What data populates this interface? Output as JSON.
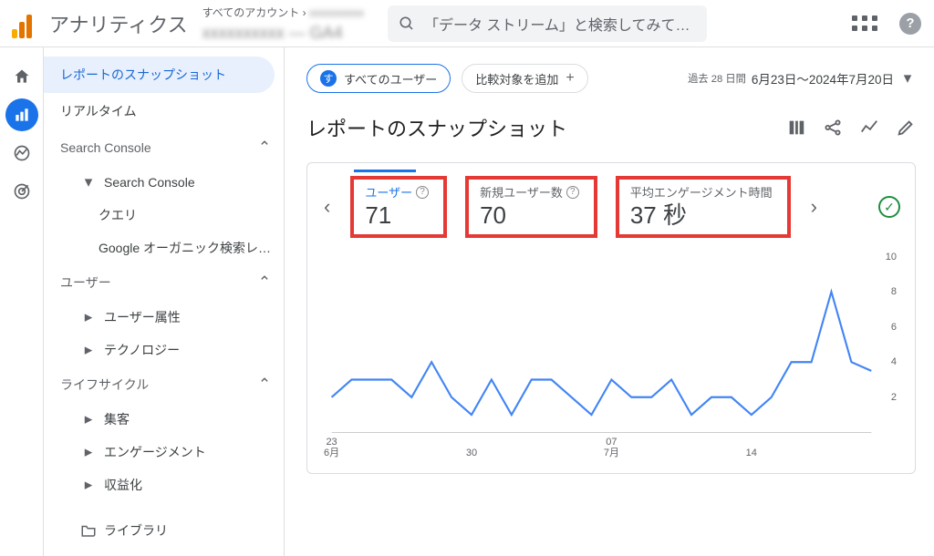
{
  "header": {
    "product_name": "アナリティクス",
    "accounts_label": "すべてのアカウント",
    "search_placeholder": "「データ ストリーム」と検索してみて…"
  },
  "sidebar": {
    "items": {
      "snapshot": "レポートのスナップショット",
      "realtime": "リアルタイム"
    },
    "sections": {
      "search_console": "Search Console",
      "search_console_group": "Search Console",
      "queries": "クエリ",
      "organic": "Google オーガニック検索レ…",
      "user": "ユーザー",
      "user_attr": "ユーザー属性",
      "technology": "テクノロジー",
      "lifecycle": "ライフサイクル",
      "acquisition": "集客",
      "engagement": "エンゲージメント",
      "monetization": "収益化",
      "library": "ライブラリ"
    }
  },
  "chips": {
    "all_users": "すべてのユーザー",
    "all_users_badge": "す",
    "add_compare": "比較対象を追加"
  },
  "date_range": {
    "prefix": "過去 28 日間",
    "range": "6月23日～2024年7月20日"
  },
  "page_title": "レポートのスナップショット",
  "metrics": {
    "users": {
      "label": "ユーザー",
      "value": "71"
    },
    "new_users": {
      "label": "新規ユーザー数",
      "value": "70"
    },
    "avg_engagement": {
      "label": "平均エンゲージメント時間",
      "value": "37 秒"
    }
  },
  "chart_data": {
    "type": "line",
    "title": "",
    "ylabel": "",
    "ylim": [
      0,
      10
    ],
    "yticks": [
      0,
      2,
      4,
      6,
      8,
      10
    ],
    "x_dates": [
      "6月23",
      "6月24",
      "6月25",
      "6月26",
      "6月27",
      "6月28",
      "6月29",
      "6月30",
      "7月01",
      "7月02",
      "7月03",
      "7月04",
      "7月05",
      "7月06",
      "7月07",
      "7月08",
      "7月09",
      "7月10",
      "7月11",
      "7月12",
      "7月13",
      "7月14",
      "7月15",
      "7月16",
      "7月17",
      "7月18",
      "7月19",
      "7月20"
    ],
    "x_tick_labels": [
      {
        "pos": 0,
        "line1": "23",
        "line2": "6月"
      },
      {
        "pos": 7,
        "line1": "30",
        "line2": ""
      },
      {
        "pos": 14,
        "line1": "07",
        "line2": "7月"
      },
      {
        "pos": 21,
        "line1": "14",
        "line2": ""
      }
    ],
    "series": [
      {
        "name": "ユーザー",
        "color": "#4285f4",
        "values": [
          2,
          3,
          3,
          3,
          2,
          4,
          2,
          1,
          3,
          1,
          3,
          3,
          2,
          1,
          3,
          2,
          2,
          3,
          1,
          2,
          2,
          1,
          2,
          4,
          4,
          8,
          4,
          3.5
        ]
      }
    ]
  }
}
